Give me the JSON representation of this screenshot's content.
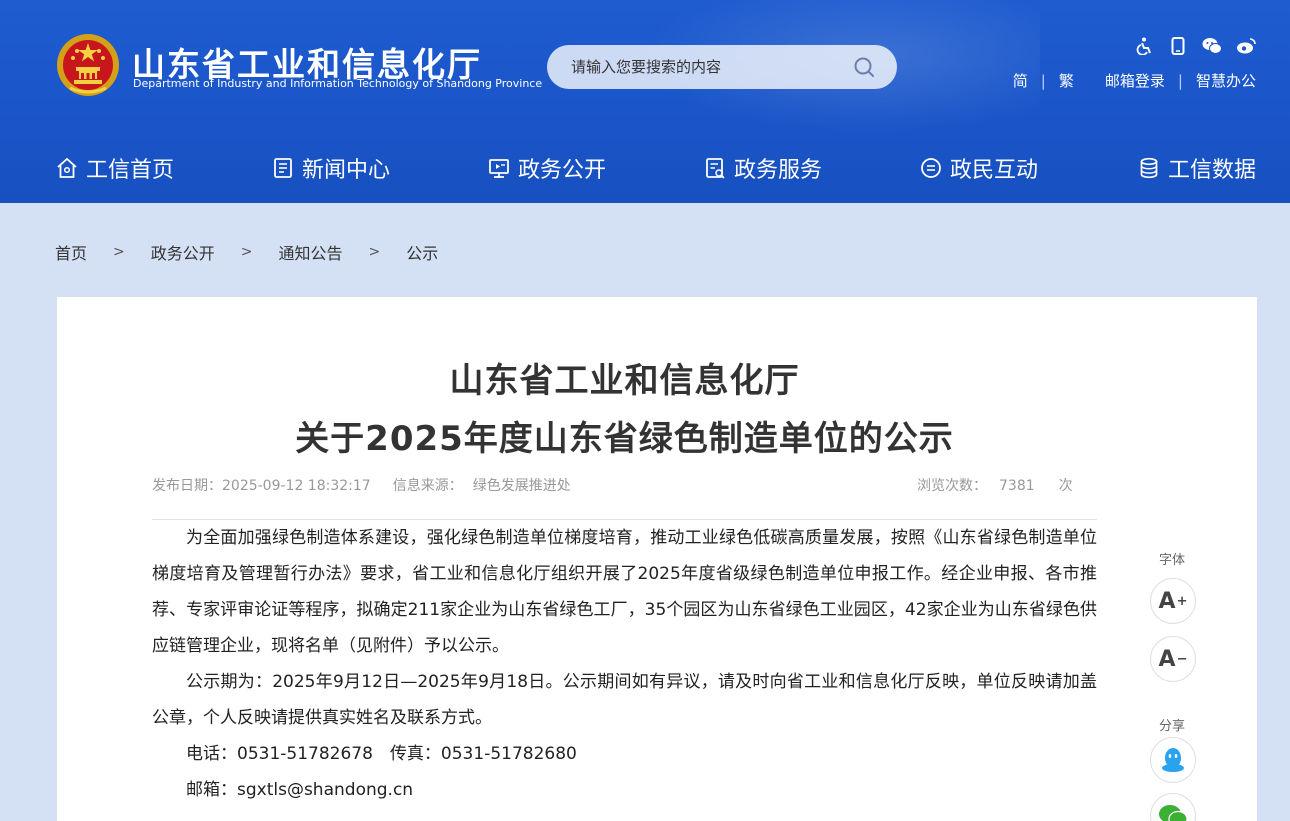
{
  "header": {
    "title": "山东省工业和信息化厅",
    "subtitle": "Department of Industry and Information Technology of Shandong Province",
    "search_placeholder": "请输入您要搜索的内容",
    "icons": [
      "accessibility-icon",
      "mobile-icon",
      "wechat-icon",
      "weibo-icon"
    ],
    "links": [
      "简",
      "繁",
      "邮箱登录",
      "智慧办公"
    ]
  },
  "nav": [
    {
      "label": "工信首页",
      "icon": "home-icon"
    },
    {
      "label": "新闻中心",
      "icon": "news-icon"
    },
    {
      "label": "政务公开",
      "icon": "public-affairs-icon"
    },
    {
      "label": "政务服务",
      "icon": "service-icon"
    },
    {
      "label": "政民互动",
      "icon": "interaction-icon"
    },
    {
      "label": "工信数据",
      "icon": "database-icon"
    }
  ],
  "breadcrumb": [
    "首页",
    "政务公开",
    "通知公告",
    "公示"
  ],
  "article": {
    "title_line1": "山东省工业和信息化厅",
    "title_line2": "关于2025年度山东省绿色制造单位的公示",
    "date_label": "发布日期：",
    "date": "2025-09-12 18:32:17",
    "source_label": "信息来源：",
    "source": "绿色发展推进处",
    "views_label": "浏览次数：",
    "views": "7381",
    "views_unit": "次",
    "paragraphs": [
      "为全面加强绿色制造体系建设，强化绿色制造单位梯度培育，推动工业绿色低碳高质量发展，按照《山东省绿色制造单位梯度培育及管理暂行办法》要求，省工业和信息化厅组织开展了2025年度省级绿色制造单位申报工作。经企业申报、各市推荐、专家评审论证等程序，拟确定211家企业为山东省绿色工厂，35个园区为山东省绿色工业园区，42家企业为山东省绿色供应链管理企业，现将名单（见附件）予以公示。",
      "公示期为：2025年9月12日—2025年9月18日。公示期间如有异议，请及时向省工业和信息化厅反映，单位反映请加盖公章，个人反映请提供真实姓名及联系方式。",
      "电话：0531-51782678　传真：0531-51782680",
      "邮箱：sgxtls@shandong.cn"
    ]
  },
  "tools": {
    "font_label": "字体",
    "font_increase": "A",
    "font_decrease": "A",
    "share_label": "分享"
  },
  "colors": {
    "header_blue": "#1a55c8",
    "page_bg": "#d4e1f5"
  }
}
